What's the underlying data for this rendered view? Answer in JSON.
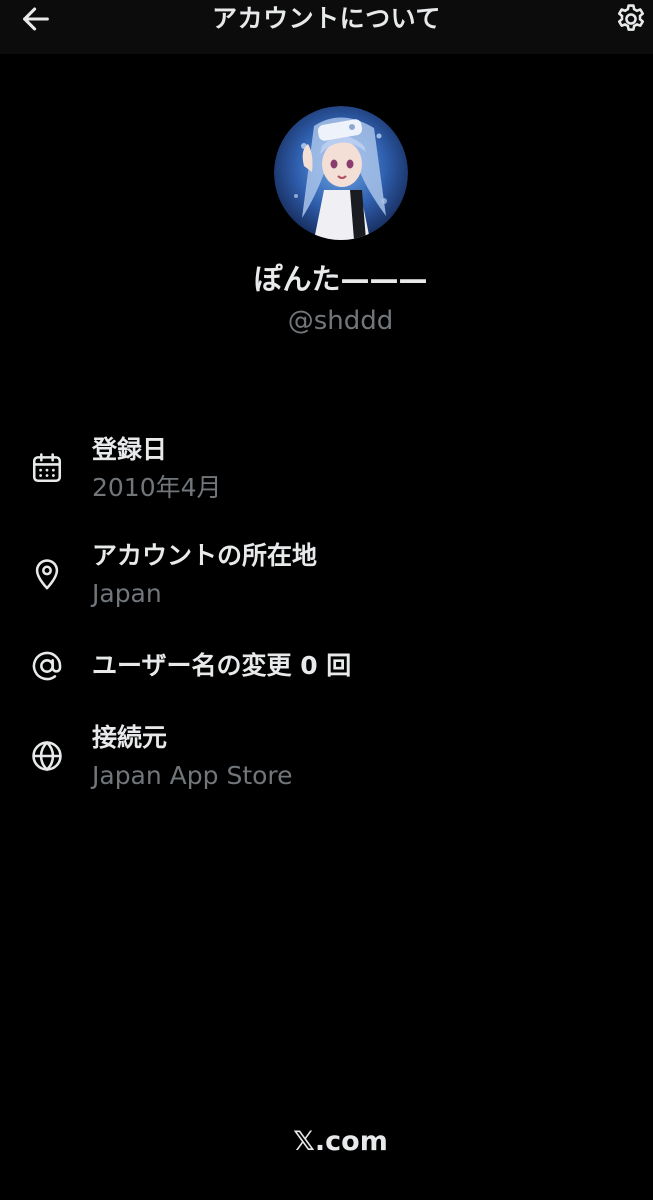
{
  "header": {
    "title": "アカウントについて",
    "back_icon": "arrow-left-icon",
    "settings_icon": "gear-icon"
  },
  "profile": {
    "display_name": "ぽんた———",
    "handle": "@shddd"
  },
  "details": [
    {
      "icon": "calendar-icon",
      "label": "登録日",
      "value": "2010年4月"
    },
    {
      "icon": "location-pin-icon",
      "label": "アカウントの所在地",
      "value": "Japan"
    },
    {
      "icon": "at-sign-icon",
      "label": "ユーザー名の変更 0 回",
      "value": ""
    },
    {
      "icon": "globe-icon",
      "label": "接続元",
      "value": "Japan App Store"
    }
  ],
  "footer": {
    "text": "𝕏.com"
  },
  "colors": {
    "background": "#000000",
    "topbar": "#0c0c0c",
    "primary_text": "#e7e9ea",
    "secondary_text": "#71767b"
  }
}
